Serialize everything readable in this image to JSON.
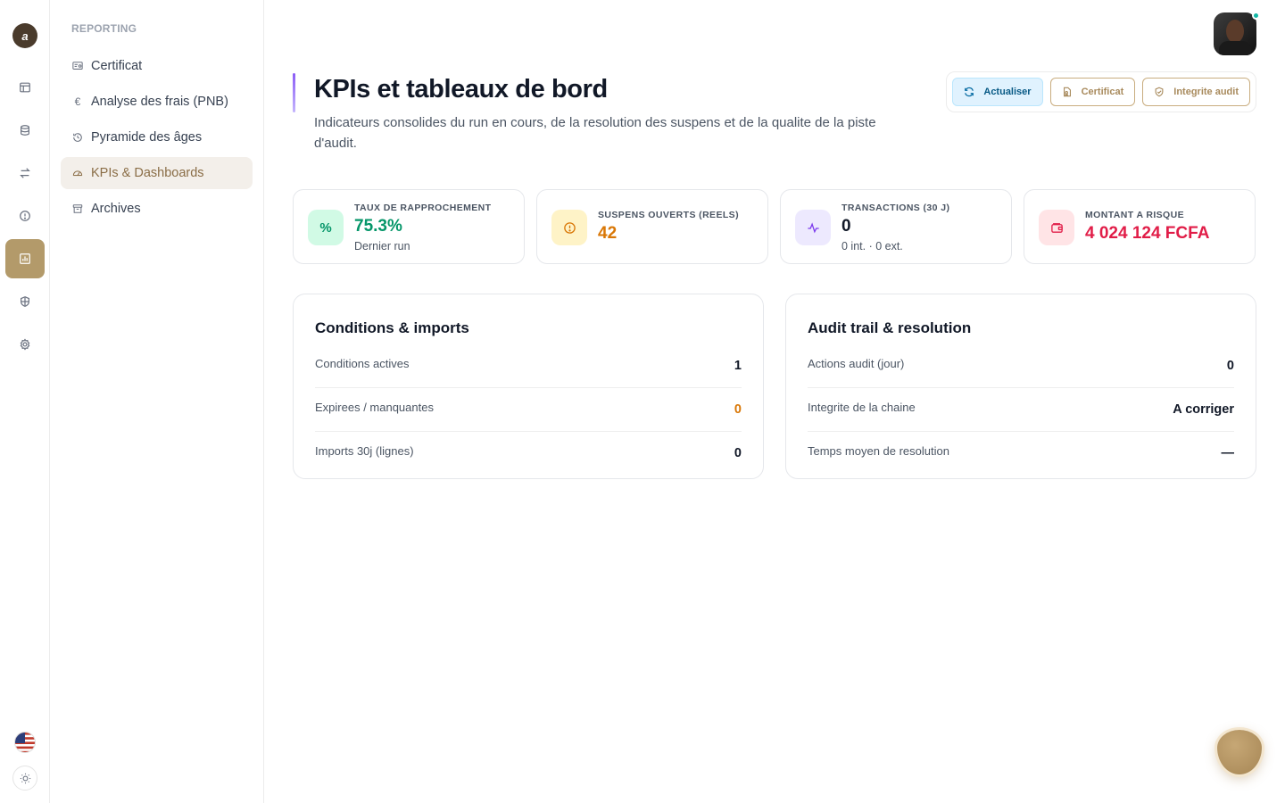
{
  "colors": {
    "accent": "#b39a6a",
    "primary_btn_bg": "#e0f2fe",
    "green": "#059669",
    "orange": "#d97706",
    "crimson": "#e11d48"
  },
  "rail": {
    "logo_text": "a",
    "items": [
      {
        "icon": "layout-icon"
      },
      {
        "icon": "database-icon"
      },
      {
        "icon": "arrows-swap-icon"
      },
      {
        "icon": "alert-circle-icon"
      },
      {
        "icon": "bar-chart-icon",
        "active": true
      },
      {
        "icon": "shield-icon"
      },
      {
        "icon": "settings-icon"
      }
    ],
    "flag": "us-flag-icon",
    "theme": "sun-icon"
  },
  "subnav": {
    "section": "REPORTING",
    "items": [
      {
        "label": "Certificat",
        "icon": "certificate-icon"
      },
      {
        "label": "Analyse des frais (PNB)",
        "icon": "euro-icon"
      },
      {
        "label": "Pyramide des âges",
        "icon": "history-icon"
      },
      {
        "label": "KPIs & Dashboards",
        "icon": "gauge-icon",
        "active": true
      },
      {
        "label": "Archives",
        "icon": "archive-icon"
      }
    ]
  },
  "header": {
    "title": "KPIs et tableaux de bord",
    "subtitle": "Indicateurs consolides du run en cours, de la resolution des suspens et de la qualite de la piste d'audit.",
    "actions": {
      "refresh": "Actualiser",
      "certificate": "Certificat",
      "integrity": "Integrite audit"
    }
  },
  "kpis": [
    {
      "label": "TAUX DE RAPPROCHEMENT",
      "value": "75.3%",
      "sub": "Dernier run",
      "icon": "percent-icon"
    },
    {
      "label": "SUSPENS OUVERTS (REELS)",
      "value": "42",
      "icon": "alert-circle-icon"
    },
    {
      "label": "TRANSACTIONS (30 J)",
      "value": "0",
      "sub": "0 int. · 0 ext.",
      "icon": "activity-icon"
    },
    {
      "label": "MONTANT A RISQUE",
      "value": "4 024 124 FCFA",
      "icon": "wallet-icon"
    }
  ],
  "panels": {
    "conditions": {
      "title": "Conditions & imports",
      "rows": [
        {
          "label": "Conditions actives",
          "value": "1"
        },
        {
          "label": "Expirees / manquantes",
          "value": "0"
        },
        {
          "label": "Imports 30j (lignes)",
          "value": "0"
        }
      ]
    },
    "audit": {
      "title": "Audit trail & resolution",
      "rows": [
        {
          "label": "Actions audit (jour)",
          "value": "0"
        },
        {
          "label": "Integrite de la chaine",
          "value": "A corriger"
        },
        {
          "label": "Temps moyen de resolution",
          "value": "—"
        }
      ]
    }
  }
}
